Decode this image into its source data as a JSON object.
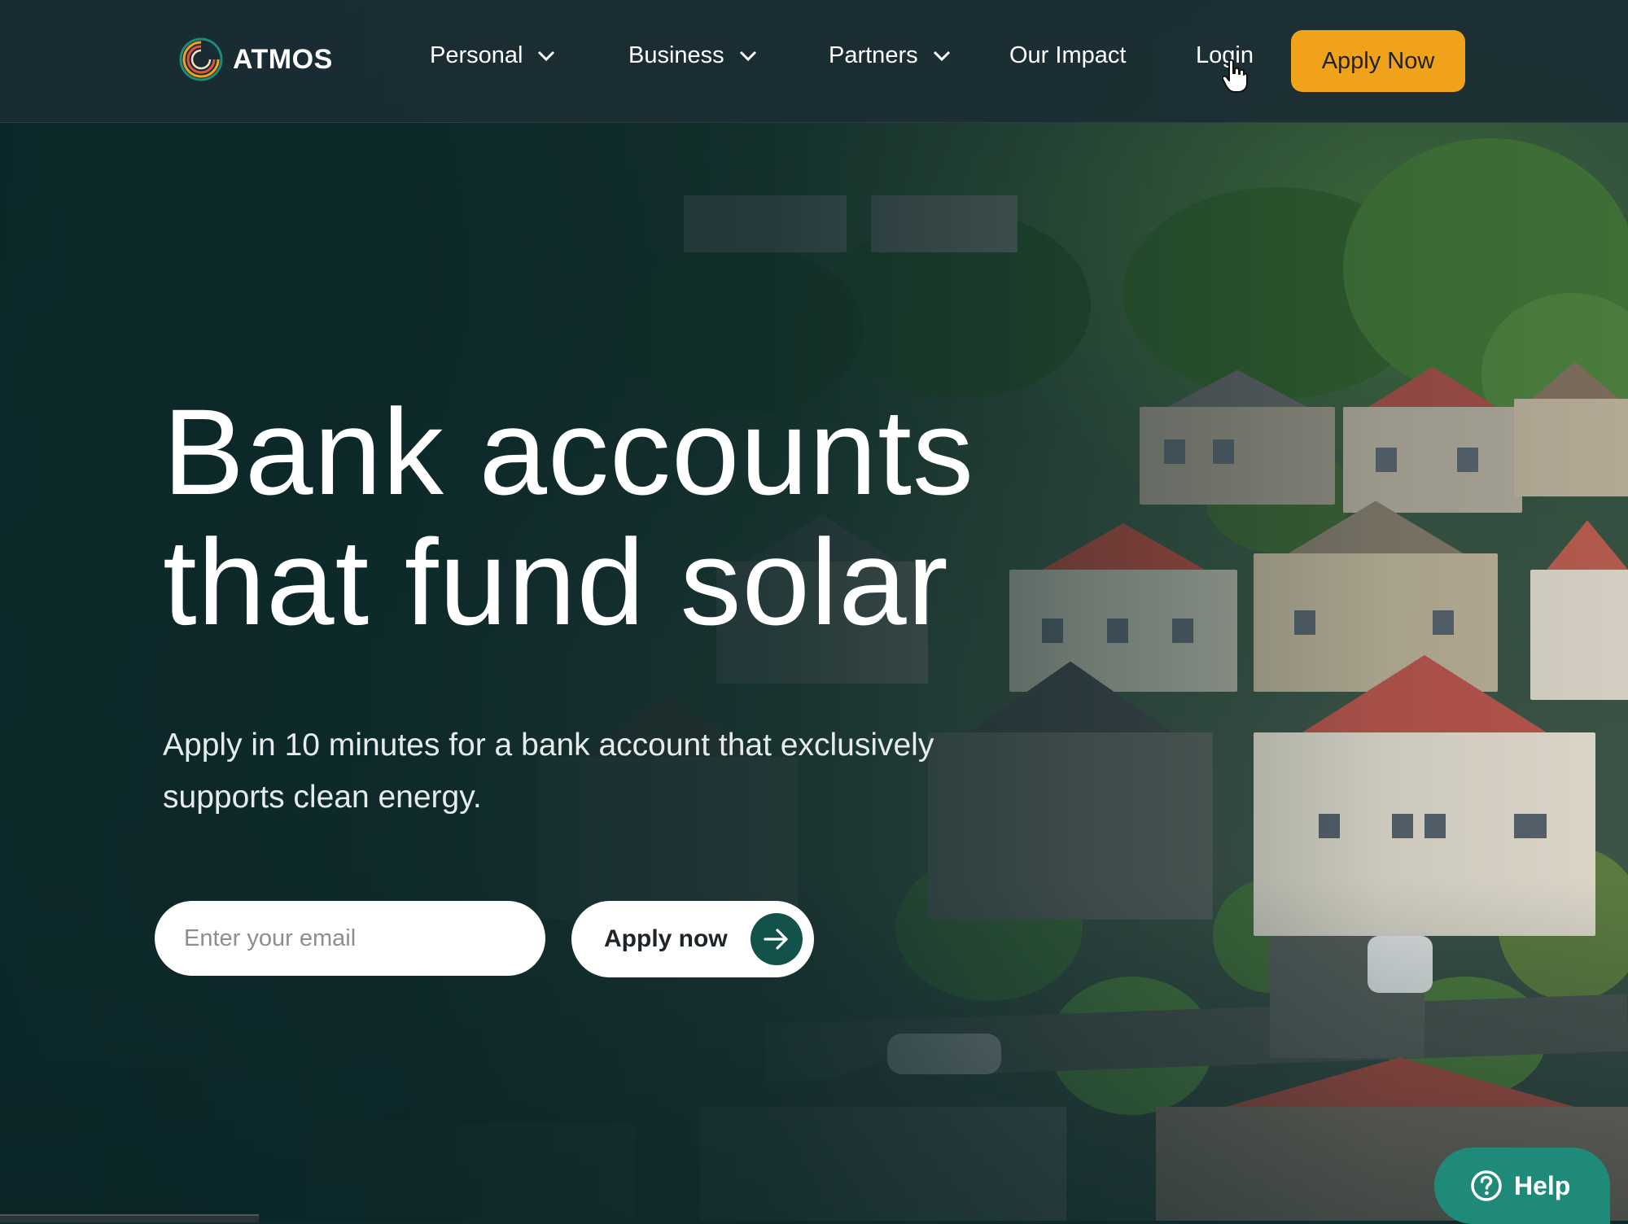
{
  "brand": {
    "name": "ATMOS"
  },
  "nav": {
    "items": [
      {
        "label": "Personal",
        "has_dropdown": true
      },
      {
        "label": "Business",
        "has_dropdown": true
      },
      {
        "label": "Partners",
        "has_dropdown": true
      },
      {
        "label": "Our Impact",
        "has_dropdown": false
      },
      {
        "label": "Login",
        "has_dropdown": false
      }
    ],
    "cta_label": "Apply Now"
  },
  "hero": {
    "title_line1": "Bank accounts",
    "title_line2": "that fund solar",
    "subtitle": "Apply in 10 minutes for a bank account that exclusively supports clean energy.",
    "email_placeholder": "Enter your email",
    "apply_label": "Apply now"
  },
  "help": {
    "label": "Help"
  },
  "colors": {
    "accent": "#f0a21b",
    "brand_green": "#12524a",
    "help_teal": "#1f8a78",
    "nav_bg": "#1b2d34"
  },
  "icons": {
    "logo": "atmos-ring-logo",
    "dropdown": "chevron-down-icon",
    "arrow": "arrow-right-icon",
    "help": "question-circle-icon",
    "cursor": "hand-pointer-icon"
  }
}
